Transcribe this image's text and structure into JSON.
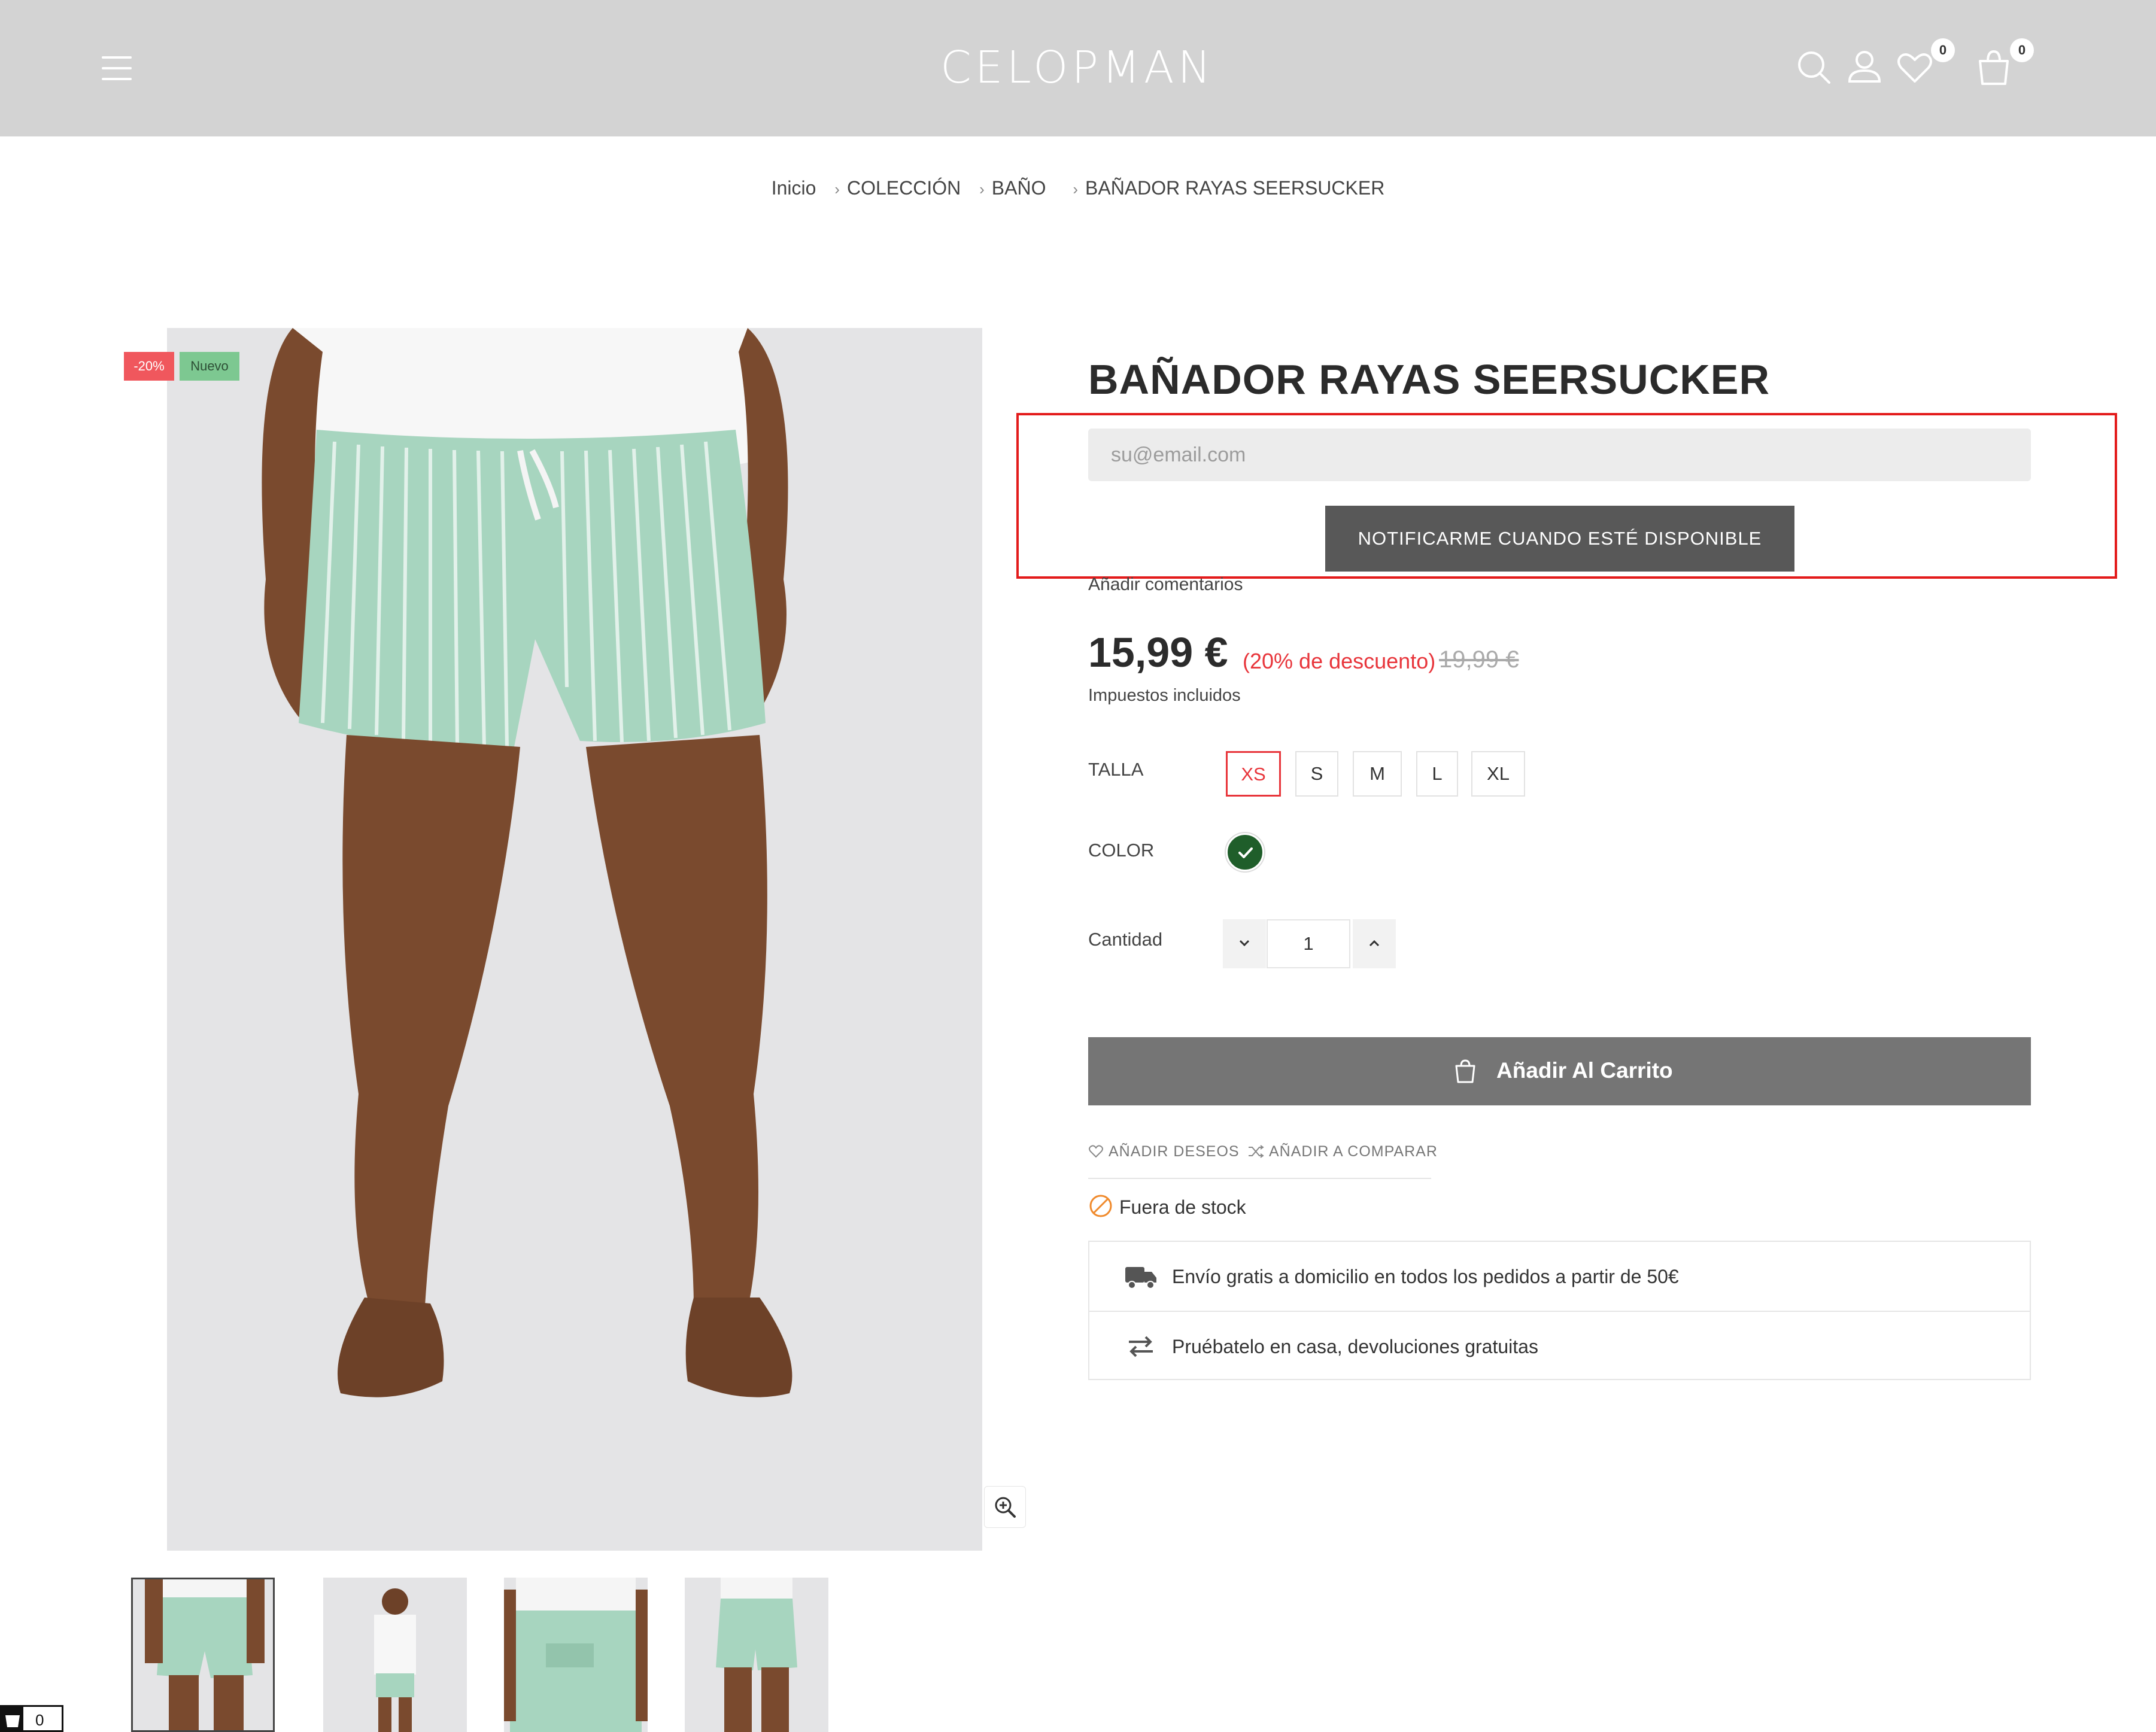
{
  "header": {
    "logo": "CELOPMAN",
    "wishlist_count": "0",
    "cart_count": "0"
  },
  "breadcrumb": {
    "home": "Inicio",
    "collection": "COLECCIÓN",
    "category": "BAÑO",
    "current": "BAÑADOR RAYAS SEERSUCKER",
    "separator": "›"
  },
  "gallery": {
    "badges": {
      "sale": "-20%",
      "new": "Nuevo"
    }
  },
  "product": {
    "title": "BAÑADOR RAYAS SEERSUCKER",
    "email_placeholder": "su@email.com",
    "notify_label": "NOTIFICARME CUANDO ESTÉ DISPONIBLE",
    "comments_link": "Añadir comentarios",
    "price": "15,99 €",
    "discount": "(20% de descuento)",
    "old_price": "19,99 €",
    "tax_note": "Impuestos incluidos",
    "size_label": "TALLA",
    "sizes": [
      "XS",
      "S",
      "M",
      "L",
      "XL"
    ],
    "selected_size": "XS",
    "color_label": "COLOR",
    "color_swatch": "#1f5e2a",
    "quantity_label": "Cantidad",
    "quantity": "1",
    "add_to_cart": "Añadir Al Carrito",
    "wishlist_link": "AÑADIR DESEOS",
    "compare_link": "AÑADIR A COMPARAR",
    "stock_status": "Fuera de stock",
    "shipping_info": "Envío gratis a domicilio en todos los pedidos a partir de 50€",
    "returns_info": "Pruébatelo en casa, devoluciones gratuitas"
  },
  "mini_cart": {
    "count": "0"
  },
  "colors": {
    "header_bg": "#d3d3d3",
    "accent_red": "#e8353b",
    "notify_button": "#585858",
    "cart_button": "#757575"
  }
}
